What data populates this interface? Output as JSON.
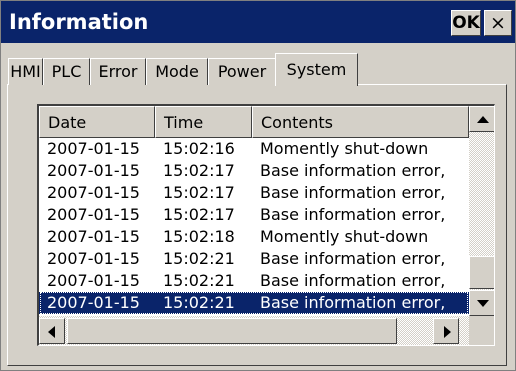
{
  "window": {
    "title": "Information",
    "ok_label": "OK",
    "close_label": "×"
  },
  "tabs": [
    {
      "label": "HMI"
    },
    {
      "label": "PLC"
    },
    {
      "label": "Error"
    },
    {
      "label": "Mode"
    },
    {
      "label": "Power"
    },
    {
      "label": "System",
      "active": true
    }
  ],
  "log": {
    "columns": [
      "Date",
      "Time",
      "Contents"
    ],
    "rows": [
      {
        "date": "2007-01-15",
        "time": "15:02:16",
        "contents": "Momently shut-down"
      },
      {
        "date": "2007-01-15",
        "time": "15:02:17",
        "contents": "Base information error,"
      },
      {
        "date": "2007-01-15",
        "time": "15:02:17",
        "contents": "Base information error,"
      },
      {
        "date": "2007-01-15",
        "time": "15:02:17",
        "contents": "Base information error,"
      },
      {
        "date": "2007-01-15",
        "time": "15:02:18",
        "contents": "Momently shut-down"
      },
      {
        "date": "2007-01-15",
        "time": "15:02:21",
        "contents": "Base information error,"
      },
      {
        "date": "2007-01-15",
        "time": "15:02:21",
        "contents": "Base information error,"
      },
      {
        "date": "2007-01-15",
        "time": "15:02:21",
        "contents": "Base information error,",
        "selected": true
      }
    ]
  },
  "colors": {
    "titlebar": "#0a246a",
    "selection": "#0a246a",
    "face": "#d4d0c8"
  }
}
